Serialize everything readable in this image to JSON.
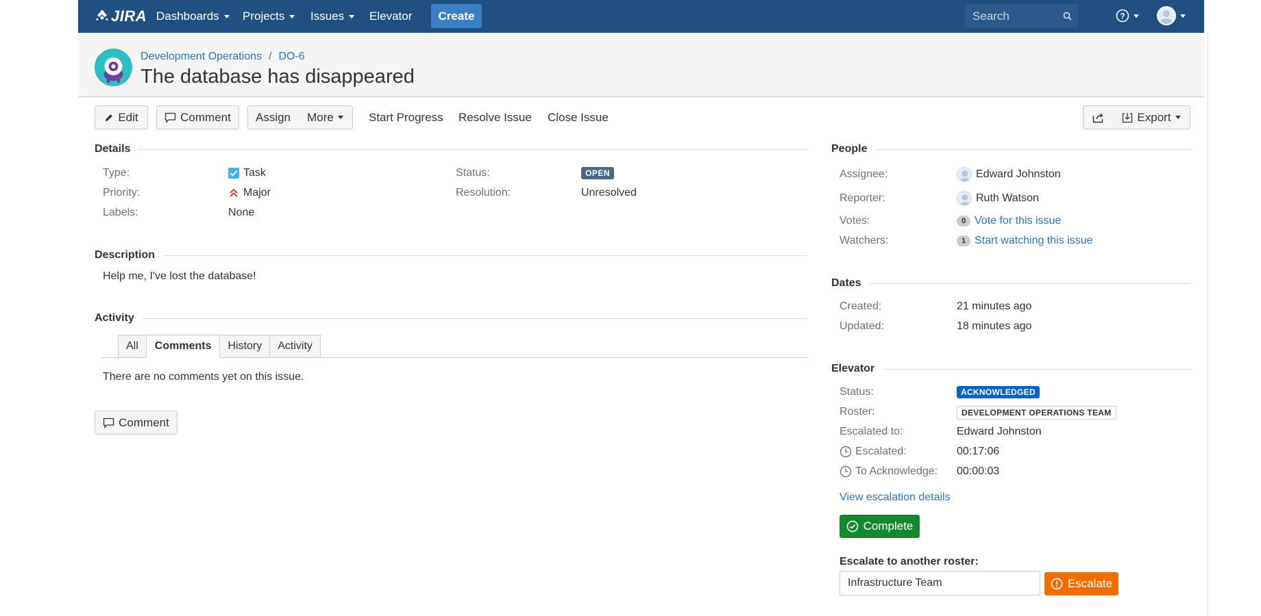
{
  "nav": {
    "logo_text": "JIRA",
    "dashboards": "Dashboards",
    "projects": "Projects",
    "issues": "Issues",
    "elevator": "Elevator",
    "create": "Create",
    "search_placeholder": "Search"
  },
  "header": {
    "project": "Development Operations",
    "separator": "/",
    "issue_key": "DO-6",
    "title": "The database has disappeared"
  },
  "toolbar": {
    "edit": "Edit",
    "comment": "Comment",
    "assign": "Assign",
    "more": "More",
    "start_progress": "Start Progress",
    "resolve_issue": "Resolve Issue",
    "close_issue": "Close Issue",
    "export": "Export"
  },
  "details": {
    "heading": "Details",
    "type_label": "Type:",
    "type_value": "Task",
    "priority_label": "Priority:",
    "priority_value": "Major",
    "labels_label": "Labels:",
    "labels_value": "None",
    "status_label": "Status:",
    "status_value": "OPEN",
    "resolution_label": "Resolution:",
    "resolution_value": "Unresolved"
  },
  "description": {
    "heading": "Description",
    "text": "Help me, I've lost the database!"
  },
  "activity": {
    "heading": "Activity",
    "tabs": [
      "All",
      "Comments",
      "History",
      "Activity"
    ],
    "active_tab": "Comments",
    "empty_text": "There are no comments yet on this issue.",
    "comment_button": "Comment"
  },
  "people": {
    "heading": "People",
    "assignee_label": "Assignee:",
    "assignee": "Edward Johnston",
    "reporter_label": "Reporter:",
    "reporter": "Ruth Watson",
    "votes_label": "Votes:",
    "votes_count": "0",
    "votes_link": "Vote for this issue",
    "watchers_label": "Watchers:",
    "watchers_count": "1",
    "watchers_link": "Start watching this issue"
  },
  "dates": {
    "heading": "Dates",
    "created_label": "Created:",
    "created": "21 minutes ago",
    "updated_label": "Updated:",
    "updated": "18 minutes ago"
  },
  "elevator": {
    "heading": "Elevator",
    "status_label": "Status:",
    "status": "ACKNOWLEDGED",
    "roster_label": "Roster:",
    "roster": "DEVELOPMENT OPERATIONS TEAM",
    "escalated_to_label": "Escalated to:",
    "escalated_to": "Edward Johnston",
    "escalated_label": "Escalated:",
    "escalated": "00:17:06",
    "to_ack_label": "To Acknowledge:",
    "to_ack": "00:00:03",
    "details_link": "View escalation details",
    "complete_button": "Complete",
    "escalate_heading": "Escalate to another roster:",
    "escalate_input_value": "Infrastructure Team",
    "escalate_button": "Escalate"
  },
  "colors": {
    "nav_bg": "#205081",
    "link": "#3572b0",
    "open_lozenge": "#4a6785",
    "ack_lozenge": "#0065c5",
    "complete_green": "#14892c",
    "escalate_orange": "#f06e00"
  }
}
